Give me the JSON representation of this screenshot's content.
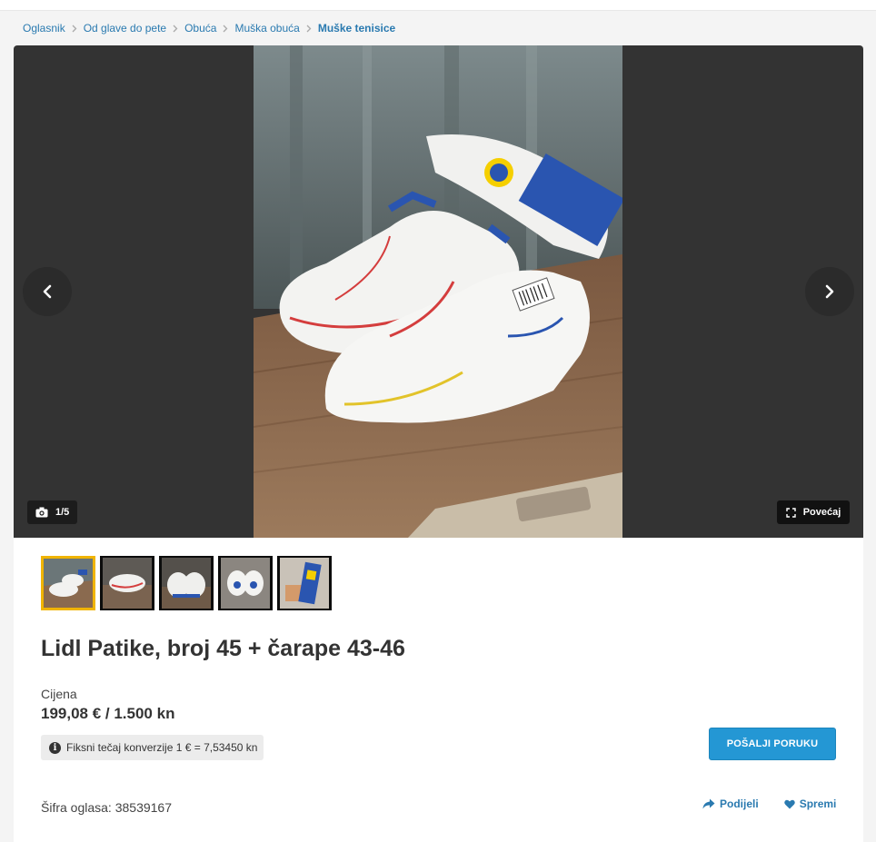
{
  "breadcrumb": {
    "items": [
      "Oglasnik",
      "Od glave do pete",
      "Obuća",
      "Muška obuća"
    ],
    "current": "Muške tenisice"
  },
  "gallery": {
    "counter": "1/5",
    "enlarge_label": "Povećaj",
    "prev_icon": "chevron-left-icon",
    "next_icon": "chevron-right-icon"
  },
  "listing": {
    "title": "Lidl Patike, broj 45 + čarape 43-46",
    "price_label": "Cijena",
    "price": "199,08 € / 1.500 kn",
    "rate_note": "Fiksni tečaj konverzije 1 € = 7,53450 kn",
    "ad_code": "Šifra oglasa: 38539167"
  },
  "actions": {
    "send_message": "POŠALJI PORUKU",
    "share": "Podijeli",
    "save": "Spremi"
  },
  "colors": {
    "link": "#2a7ab0",
    "button": "#2497d4",
    "active_thumb_border": "#f0b400",
    "gallery_bg": "#333333"
  }
}
